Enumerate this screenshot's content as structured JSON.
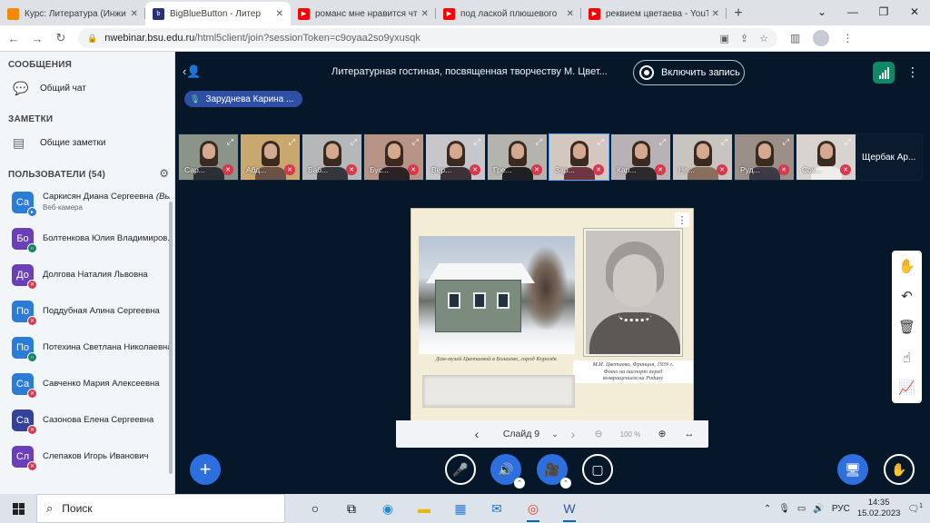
{
  "browser": {
    "tabs": [
      {
        "title": "Курс: Литература (Инжи",
        "favicon": "moodle",
        "color": "#f18a00",
        "active": false
      },
      {
        "title": "BigBlueButton - Литер",
        "favicon": "bbb",
        "color": "#283274",
        "active": true
      },
      {
        "title": "романс мне нравится чт",
        "favicon": "youtube",
        "color": "#ff0000",
        "active": false
      },
      {
        "title": "под лаской плюшевого",
        "favicon": "youtube",
        "color": "#ff0000",
        "active": false
      },
      {
        "title": "реквием цветаева - YouT",
        "favicon": "youtube",
        "color": "#ff0000",
        "active": false
      }
    ],
    "url_host": "nwebinar.bsu.edu.ru",
    "url_path": "/html5client/join?sessionToken=c9oyaa2so9yxusqk"
  },
  "sidebar": {
    "messages_title": "СООБЩЕНИЯ",
    "public_chat": "Общий чат",
    "notes_title": "ЗАМЕТКИ",
    "shared_notes": "Общие заметки",
    "users_title": "ПОЛЬЗОВАТЕЛИ",
    "users_count": "(54)",
    "users": [
      {
        "initials": "Са",
        "name": "Саркисян Диана Сергеевна",
        "you": "(Вы)",
        "sub": "Веб-камера",
        "color": "#2a7cd6",
        "status": "webcam"
      },
      {
        "initials": "Бо",
        "name": "Болтенкова Юлия Владимиров...",
        "color": "#6b3fb8",
        "status": "listen"
      },
      {
        "initials": "До",
        "name": "Долгова Наталия Львовна",
        "color": "#6b3fb8",
        "status": "muted"
      },
      {
        "initials": "По",
        "name": "Поддубная Алина Сергеевна",
        "color": "#2a7cd6",
        "status": "muted"
      },
      {
        "initials": "По",
        "name": "Потехина Светлана Николаевна",
        "color": "#2a7cd6",
        "status": "listen"
      },
      {
        "initials": "Са",
        "name": "Савченко Мария Алексеевна",
        "color": "#2a7cd6",
        "status": "muted"
      },
      {
        "initials": "Са",
        "name": "Сазонова Елена Сергеевна",
        "color": "#35419a",
        "status": "muted"
      },
      {
        "initials": "Сл",
        "name": "Слепаков Игорь Иванович",
        "color": "#6b3fb8",
        "status": "muted"
      }
    ]
  },
  "main": {
    "meeting_title": "Литературная гостиная, посвященная творчеству М. Цвет...",
    "record_label": "Включить запись",
    "talking": "Заруднева Карина ...",
    "tiles": [
      {
        "name": "Сар...",
        "bg": "#8a9488",
        "shirt": "#2c2f36"
      },
      {
        "name": "Абд...",
        "bg": "#c8a86e",
        "shirt": "#6b5046"
      },
      {
        "name": "Баб...",
        "bg": "#b5b7b9",
        "shirt": "#35363b"
      },
      {
        "name": "Бус...",
        "bg": "#b89486",
        "shirt": "#2a2224"
      },
      {
        "name": "Вер...",
        "bg": "#c7c6cb",
        "shirt": "#3b3137"
      },
      {
        "name": "Гре...",
        "bg": "#b4b3ae",
        "shirt": "#1f2024"
      },
      {
        "name": "Зар...",
        "bg": "#d3c7c0",
        "shirt": "#6e3642",
        "selected": true
      },
      {
        "name": "Кар...",
        "bg": "#b8b2b7",
        "shirt": "#2d2a2e"
      },
      {
        "name": "Не...",
        "bg": "#c8c4c0",
        "shirt": "#8a6f5f"
      },
      {
        "name": "Руд...",
        "bg": "#9b8f8a",
        "shirt": "#3c3a45"
      },
      {
        "name": "Сок...",
        "bg": "#d9d3d0",
        "shirt": "#f0eeea"
      }
    ],
    "last_tile": "Щербак Ар...",
    "slide": {
      "caption_left": "Дом-музей Цветаевой в Болшево, город Королёв",
      "caption_right_1": "М.И. Цветаева, Франция, 1939 г.",
      "caption_right_2": "Фото на паспорт перед",
      "caption_right_3": "возвращением на Родину"
    },
    "slide_label": "Слайд 9",
    "zoom": "100 %"
  },
  "taskbar": {
    "search_placeholder": "Поиск",
    "lang": "РУС",
    "time": "14:35",
    "date": "15.02.2023",
    "notif_count": "1"
  }
}
